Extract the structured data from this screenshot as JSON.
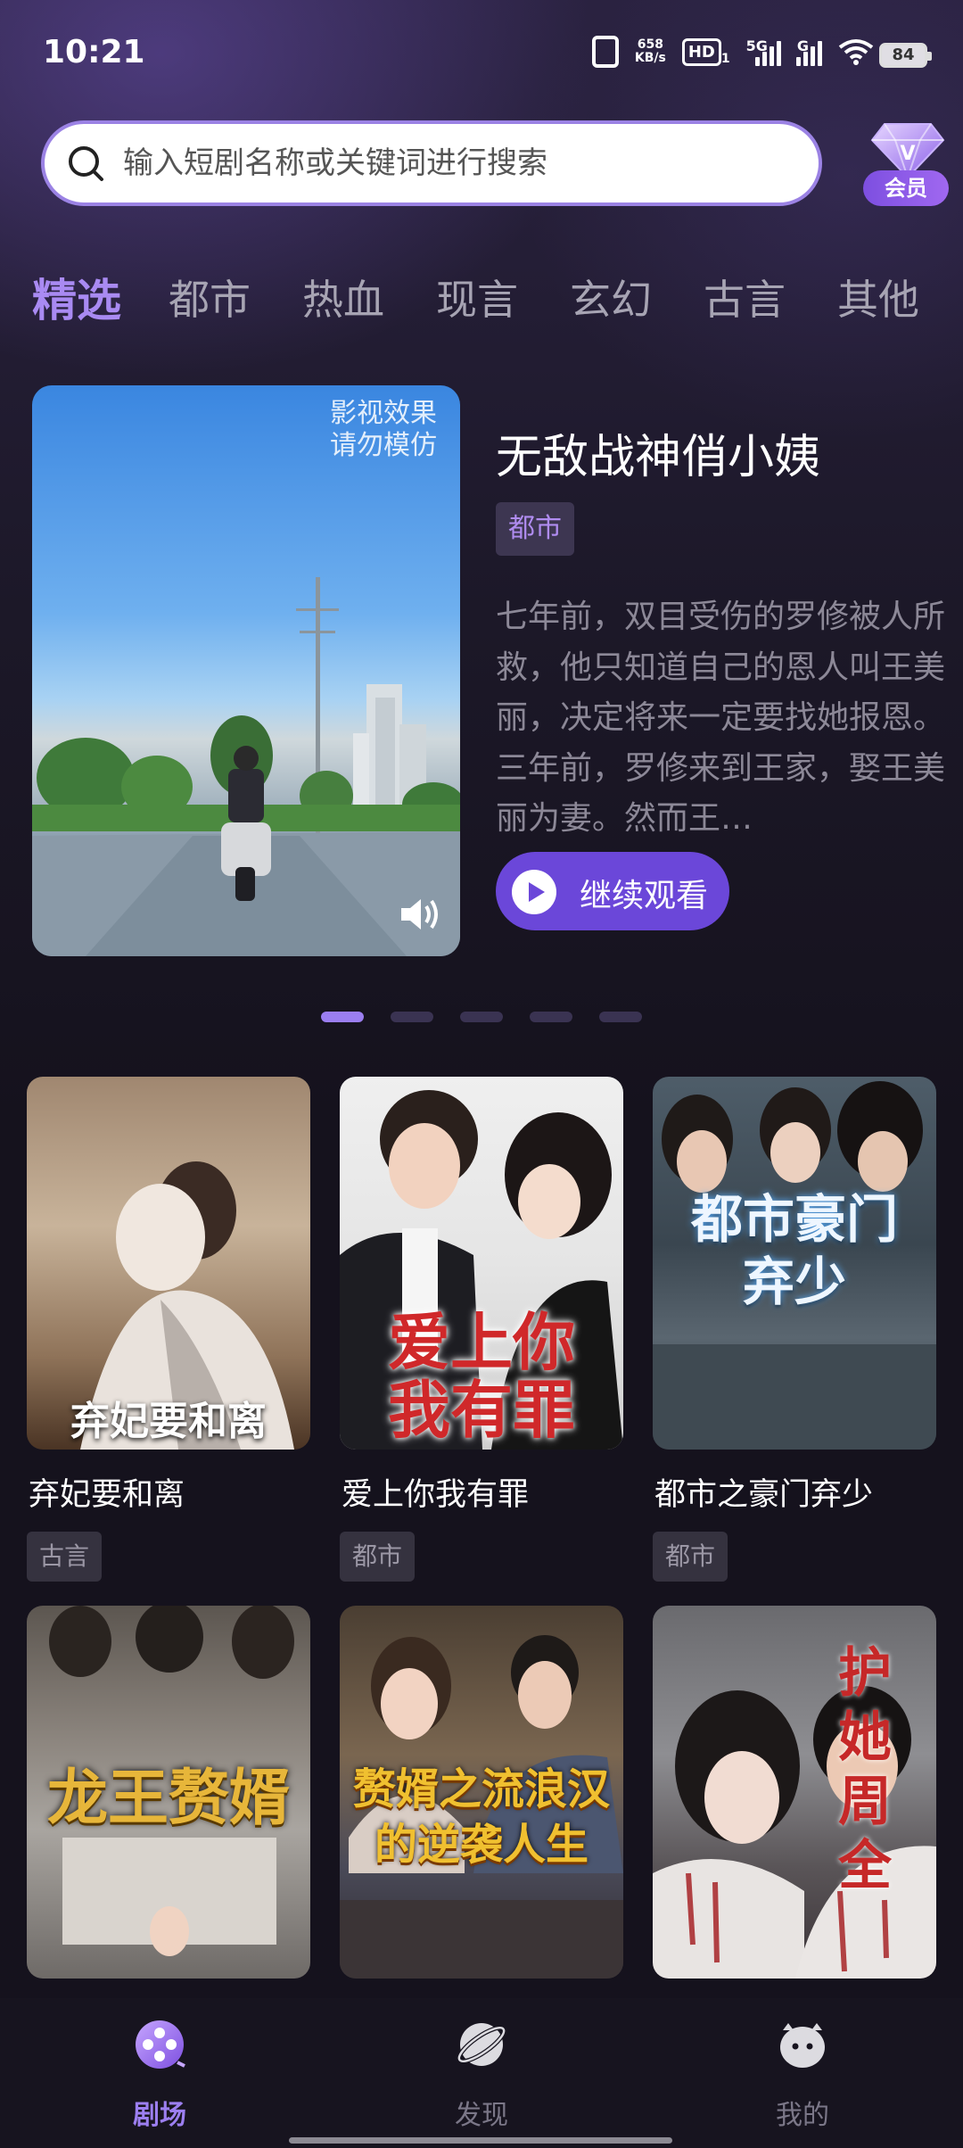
{
  "status_bar": {
    "time": "10:21",
    "net_speed_value": "658",
    "net_speed_unit": "KB/s",
    "hd_label": "HD",
    "hd_sub": "1",
    "signal1_label": "5G",
    "signal2_label": "G",
    "battery": "84"
  },
  "search": {
    "placeholder": "输入短剧名称或关键词进行搜索",
    "icon": "search-icon"
  },
  "vip": {
    "label": "会员",
    "icon": "diamond-icon"
  },
  "tabs": [
    {
      "label": "精选",
      "active": true
    },
    {
      "label": "都市"
    },
    {
      "label": "热血"
    },
    {
      "label": "现言"
    },
    {
      "label": "玄幻"
    },
    {
      "label": "古言"
    },
    {
      "label": "其他"
    }
  ],
  "featured": {
    "title": "无敌战神俏小姨",
    "tag": "都市",
    "description": "七年前，双目受伤的罗修被人所救，他只知道自己的恩人叫王美丽，决定将来一定要找她报恩。三年前，罗修来到王家，娶王美丽为妻。然而王…",
    "watermark_line1": "影视效果",
    "watermark_line2": "请勿模仿",
    "play_label": "继续观看",
    "carousel_count": 5,
    "carousel_active": 0
  },
  "dramas": [
    {
      "title": "弃妃要和离",
      "tag": "古言",
      "poster_text": "弃妃要和离",
      "accent": "#8a6a4e"
    },
    {
      "title": "爱上你我有罪",
      "tag": "都市",
      "poster_text": "爱上你我有罪",
      "accent": "#d0282a"
    },
    {
      "title": "都市之豪门弃少",
      "tag": "都市",
      "poster_text": "都市豪门弃少",
      "accent": "#4a5a66"
    },
    {
      "title": "",
      "tag": "",
      "poster_text": "龙王赘婿",
      "accent": "#e7b63a"
    },
    {
      "title": "",
      "tag": "",
      "poster_text": "赘婿之流浪汉的逆袭人生",
      "accent": "#f0c030"
    },
    {
      "title": "",
      "tag": "",
      "poster_text": "护她周全",
      "accent": "#c62828"
    }
  ],
  "bottom_nav": [
    {
      "label": "剧场",
      "icon": "theater-icon",
      "active": true
    },
    {
      "label": "发现",
      "icon": "planet-icon"
    },
    {
      "label": "我的",
      "icon": "profile-icon"
    }
  ],
  "colors": {
    "accent": "#9b7ef0",
    "play_button": "#6b47d9",
    "background": "#15121d"
  }
}
